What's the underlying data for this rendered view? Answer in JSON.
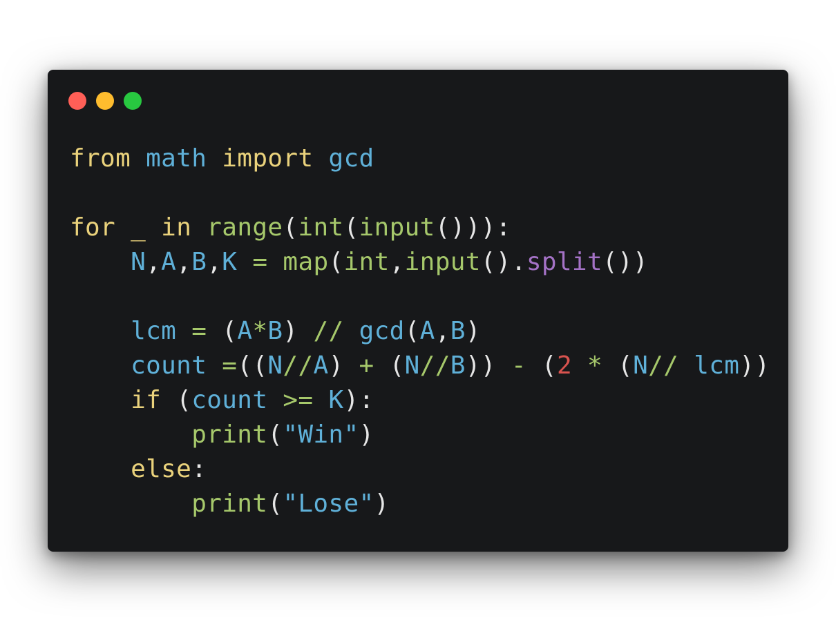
{
  "window": {
    "background": "#17181a",
    "controls": [
      {
        "name": "close-dot",
        "color": "#ff5f57"
      },
      {
        "name": "minimize-dot",
        "color": "#febc2e"
      },
      {
        "name": "maximize-dot",
        "color": "#28c840"
      }
    ]
  },
  "code_colors": {
    "keyword": "#ead27c",
    "function": "#a6c86b",
    "variable": "#5fb0d8",
    "string": "#5fb0d8",
    "number": "#d9534f",
    "method": "#a472c6",
    "punctuation": "#e6e6e6"
  },
  "code": {
    "lines": [
      [
        [
          "kw",
          "from"
        ],
        [
          "pun",
          " "
        ],
        [
          "var",
          "math"
        ],
        [
          "pun",
          " "
        ],
        [
          "kw",
          "import"
        ],
        [
          "pun",
          " "
        ],
        [
          "var",
          "gcd"
        ]
      ],
      [],
      [
        [
          "kw",
          "for"
        ],
        [
          "pun",
          " "
        ],
        [
          "kw",
          "_"
        ],
        [
          "pun",
          " "
        ],
        [
          "kw",
          "in"
        ],
        [
          "pun",
          " "
        ],
        [
          "fn",
          "range"
        ],
        [
          "pun",
          "("
        ],
        [
          "fn",
          "int"
        ],
        [
          "pun",
          "("
        ],
        [
          "fn",
          "input"
        ],
        [
          "pun",
          "())):"
        ]
      ],
      [
        [
          "pun",
          "    "
        ],
        [
          "var",
          "N"
        ],
        [
          "pun",
          ","
        ],
        [
          "var",
          "A"
        ],
        [
          "pun",
          ","
        ],
        [
          "var",
          "B"
        ],
        [
          "pun",
          ","
        ],
        [
          "var",
          "K"
        ],
        [
          "pun",
          " "
        ],
        [
          "op",
          "="
        ],
        [
          "pun",
          " "
        ],
        [
          "fn",
          "map"
        ],
        [
          "pun",
          "("
        ],
        [
          "fn",
          "int"
        ],
        [
          "pun",
          ","
        ],
        [
          "fn",
          "input"
        ],
        [
          "pun",
          "()."
        ],
        [
          "meth",
          "split"
        ],
        [
          "pun",
          "())"
        ]
      ],
      [],
      [
        [
          "pun",
          "    "
        ],
        [
          "var",
          "lcm"
        ],
        [
          "pun",
          " "
        ],
        [
          "op",
          "="
        ],
        [
          "pun",
          " ("
        ],
        [
          "var",
          "A"
        ],
        [
          "op",
          "*"
        ],
        [
          "var",
          "B"
        ],
        [
          "pun",
          ") "
        ],
        [
          "op",
          "//"
        ],
        [
          "pun",
          " "
        ],
        [
          "var",
          "gcd"
        ],
        [
          "pun",
          "("
        ],
        [
          "var",
          "A"
        ],
        [
          "pun",
          ","
        ],
        [
          "var",
          "B"
        ],
        [
          "pun",
          ")"
        ]
      ],
      [
        [
          "pun",
          "    "
        ],
        [
          "var",
          "count"
        ],
        [
          "pun",
          " "
        ],
        [
          "op",
          "="
        ],
        [
          "pun",
          "(("
        ],
        [
          "var",
          "N"
        ],
        [
          "op",
          "//"
        ],
        [
          "var",
          "A"
        ],
        [
          "pun",
          ") "
        ],
        [
          "op",
          "+"
        ],
        [
          "pun",
          " ("
        ],
        [
          "var",
          "N"
        ],
        [
          "op",
          "//"
        ],
        [
          "var",
          "B"
        ],
        [
          "pun",
          ")) "
        ],
        [
          "op",
          "-"
        ],
        [
          "pun",
          " ("
        ],
        [
          "num",
          "2"
        ],
        [
          "pun",
          " "
        ],
        [
          "op",
          "*"
        ],
        [
          "pun",
          " ("
        ],
        [
          "var",
          "N"
        ],
        [
          "op",
          "//"
        ],
        [
          "pun",
          " "
        ],
        [
          "var",
          "lcm"
        ],
        [
          "pun",
          "))"
        ]
      ],
      [
        [
          "pun",
          "    "
        ],
        [
          "kw",
          "if"
        ],
        [
          "pun",
          " ("
        ],
        [
          "var",
          "count"
        ],
        [
          "pun",
          " "
        ],
        [
          "op",
          ">="
        ],
        [
          "pun",
          " "
        ],
        [
          "var",
          "K"
        ],
        [
          "pun",
          "):"
        ]
      ],
      [
        [
          "pun",
          "        "
        ],
        [
          "fn",
          "print"
        ],
        [
          "pun",
          "("
        ],
        [
          "str",
          "\"Win\""
        ],
        [
          "pun",
          ")"
        ]
      ],
      [
        [
          "pun",
          "    "
        ],
        [
          "kw",
          "else"
        ],
        [
          "pun",
          ":"
        ]
      ],
      [
        [
          "pun",
          "        "
        ],
        [
          "fn",
          "print"
        ],
        [
          "pun",
          "("
        ],
        [
          "str",
          "\"Lose\""
        ],
        [
          "pun",
          ")"
        ]
      ]
    ]
  }
}
